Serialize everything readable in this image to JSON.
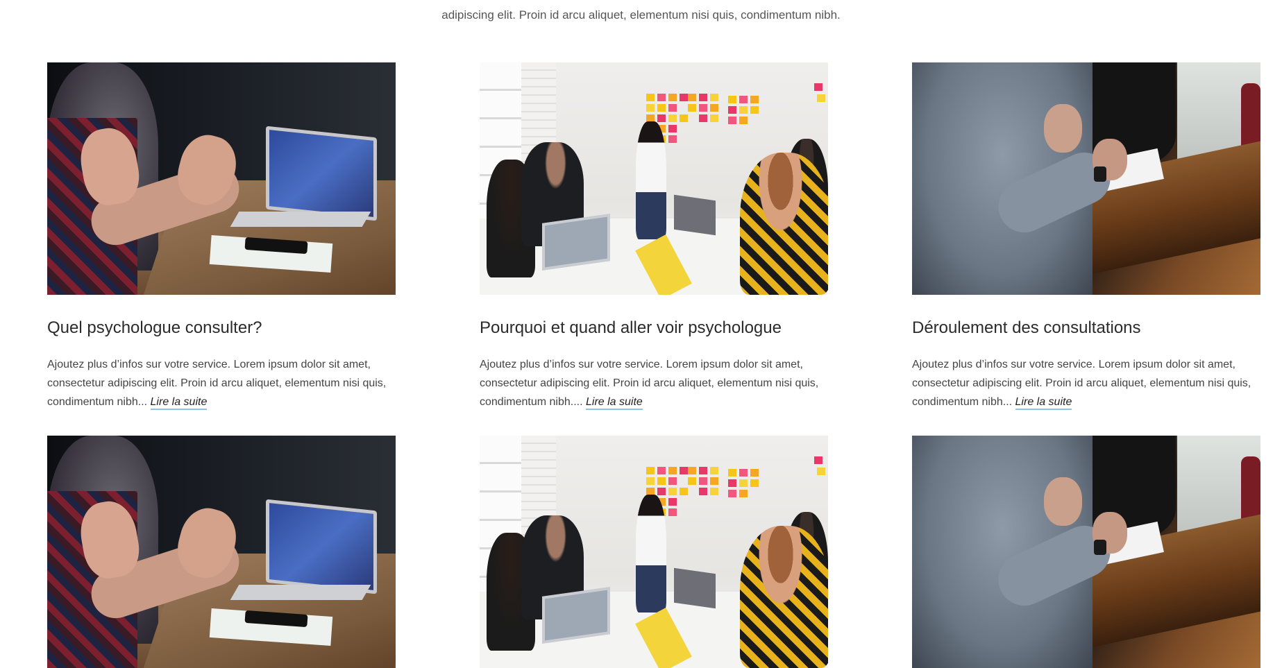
{
  "intro": {
    "text": "adipiscing elit. Proin id arcu aliquet, elementum nisi quis, condimentum nibh."
  },
  "cards": [
    {
      "title": "Quel psychologue consulter?",
      "description": "Ajoutez plus d’infos sur votre service. Lorem ipsum dolor sit amet, consectetur adipiscing elit. Proin id arcu aliquet, elementum nisi quis, condimentum nibh...",
      "more": "Lire la suite"
    },
    {
      "title": "Pourquoi et quand aller voir psychologue",
      "description": "Ajoutez plus d’infos sur votre service. Lorem ipsum dolor sit amet, consectetur adipiscing elit. Proin id arcu aliquet, elementum nisi quis, condimentum nibh....",
      "more": "Lire la suite"
    },
    {
      "title": "Déroulement des consultations",
      "description": "Ajoutez plus d’infos sur votre service. Lorem ipsum dolor sit amet, consectetur adipiscing elit. Proin id arcu aliquet, elementum nisi quis, condimentum nibh...",
      "more": "Lire la suite"
    }
  ],
  "images": [
    "laptop-meeting-photo",
    "sticky-notes-meeting-photo",
    "table-discussion-photo"
  ],
  "colors": {
    "link_underline": "#8fc3df",
    "title": "#2b2b2b",
    "body_text": "#444444"
  }
}
